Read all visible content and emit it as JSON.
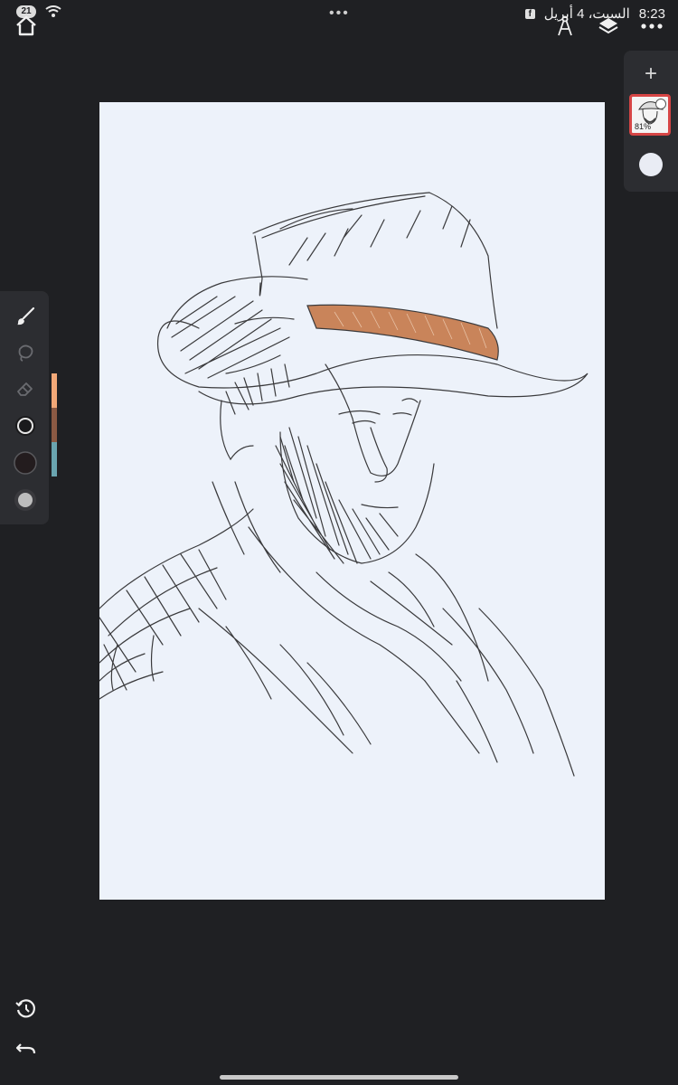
{
  "status_bar": {
    "notification_count": "21",
    "time": "8:23",
    "date": "السبت، 4 أبريل",
    "center_dots": "•••"
  },
  "toolbar_top": {
    "home_icon": "home-icon",
    "right_icons": [
      "compass-icon",
      "layers-icon",
      "more-icon"
    ]
  },
  "layers": {
    "add_label": "+",
    "current_layer_opacity": "81%"
  },
  "tools": {
    "items": [
      "brush-icon",
      "lasso-icon",
      "eraser-icon",
      "brush-size-icon",
      "color-icon",
      "opacity-icon"
    ],
    "recent_colors": [
      "#f2a878",
      "#8b5a44",
      "#6aa5b0"
    ]
  },
  "bottom": {
    "icons": [
      "history-icon",
      "undo-icon"
    ]
  },
  "colors": {
    "background": "#1f2023",
    "panel": "#2c2d31",
    "canvas": "#edf2fa",
    "layer_select": "#d64545"
  }
}
